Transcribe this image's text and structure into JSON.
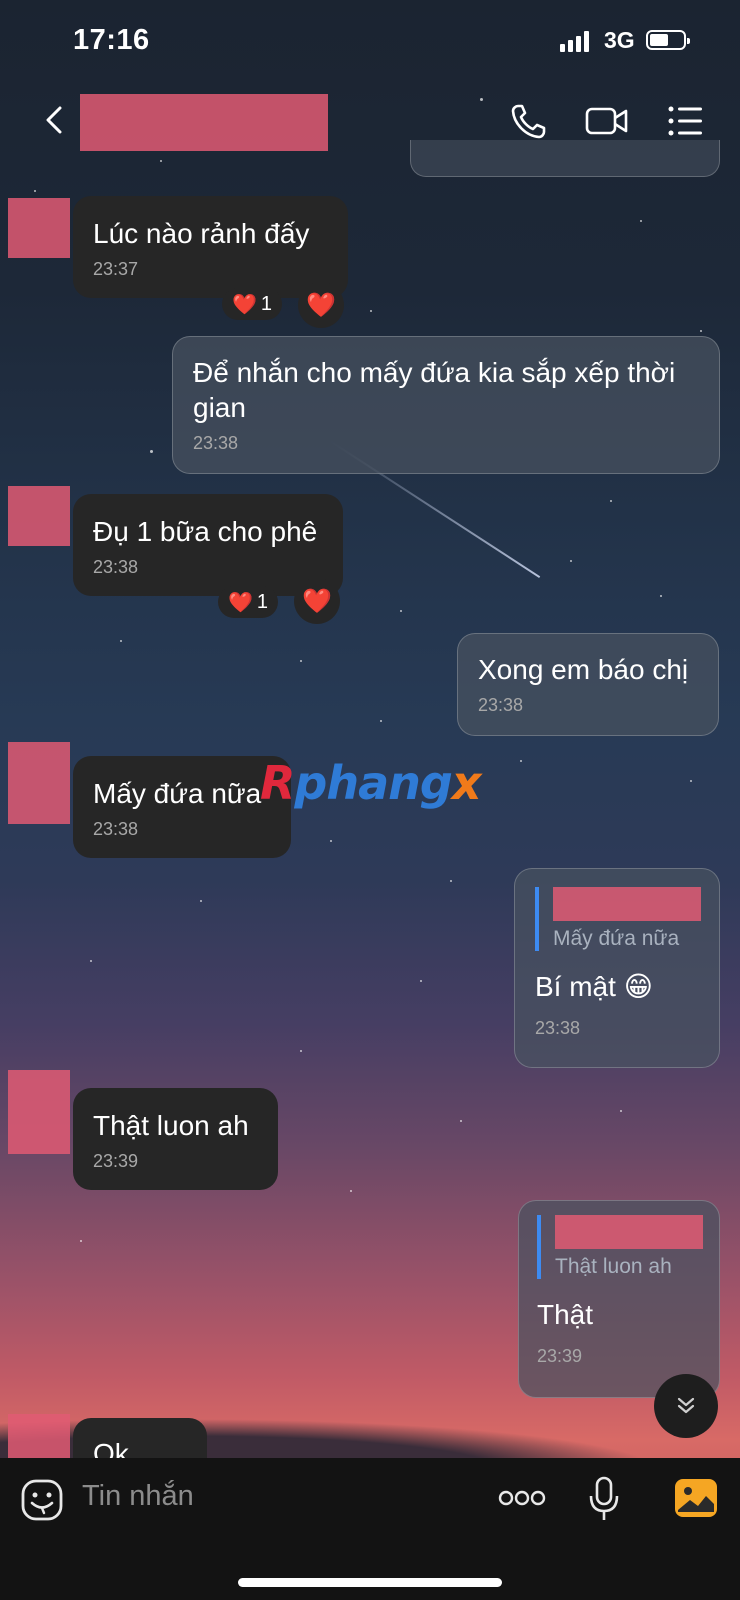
{
  "status_bar": {
    "time": "17:16",
    "network": "3G"
  },
  "header": {
    "back_icon": "chevron-left-icon",
    "call_icon": "phone-icon",
    "video_icon": "video-camera-icon",
    "menu_icon": "list-menu-icon"
  },
  "messages": [
    {
      "dir": "in",
      "text": "Lúc nào rảnh đấy",
      "time": "23:37",
      "reaction_count": "1"
    },
    {
      "dir": "out",
      "text": "Để nhắn cho mấy đứa kia sắp xếp thời gian",
      "time": "23:38"
    },
    {
      "dir": "in",
      "text": "Đụ 1 bữa cho phê",
      "time": "23:38",
      "reaction_count": "1"
    },
    {
      "dir": "out",
      "text": "Xong em báo chị",
      "time": "23:38"
    },
    {
      "dir": "in",
      "text": "Mấy đứa nữa",
      "time": "23:38"
    },
    {
      "dir": "out",
      "quote": "Mấy đứa nữa",
      "text": "Bí mật 😁",
      "time": "23:38"
    },
    {
      "dir": "in",
      "text": "Thật luon ah",
      "time": "23:39"
    },
    {
      "dir": "out",
      "quote": "Thật luon ah",
      "text": "Thật",
      "time": "23:39"
    },
    {
      "dir": "in",
      "text": "Ok"
    }
  ],
  "watermark": {
    "part1": "R",
    "part2": "phang",
    "part3": "x"
  },
  "input": {
    "placeholder": "Tin nhắn",
    "emoji_icon": "emoji-sticker-icon",
    "more_icon": "more-dots-icon",
    "mic_icon": "microphone-icon",
    "image_icon": "image-gallery-icon"
  },
  "colors": {
    "accent_quote": "#3d8bf2",
    "redaction": "#e05a73",
    "image_button": "#f5a623"
  }
}
